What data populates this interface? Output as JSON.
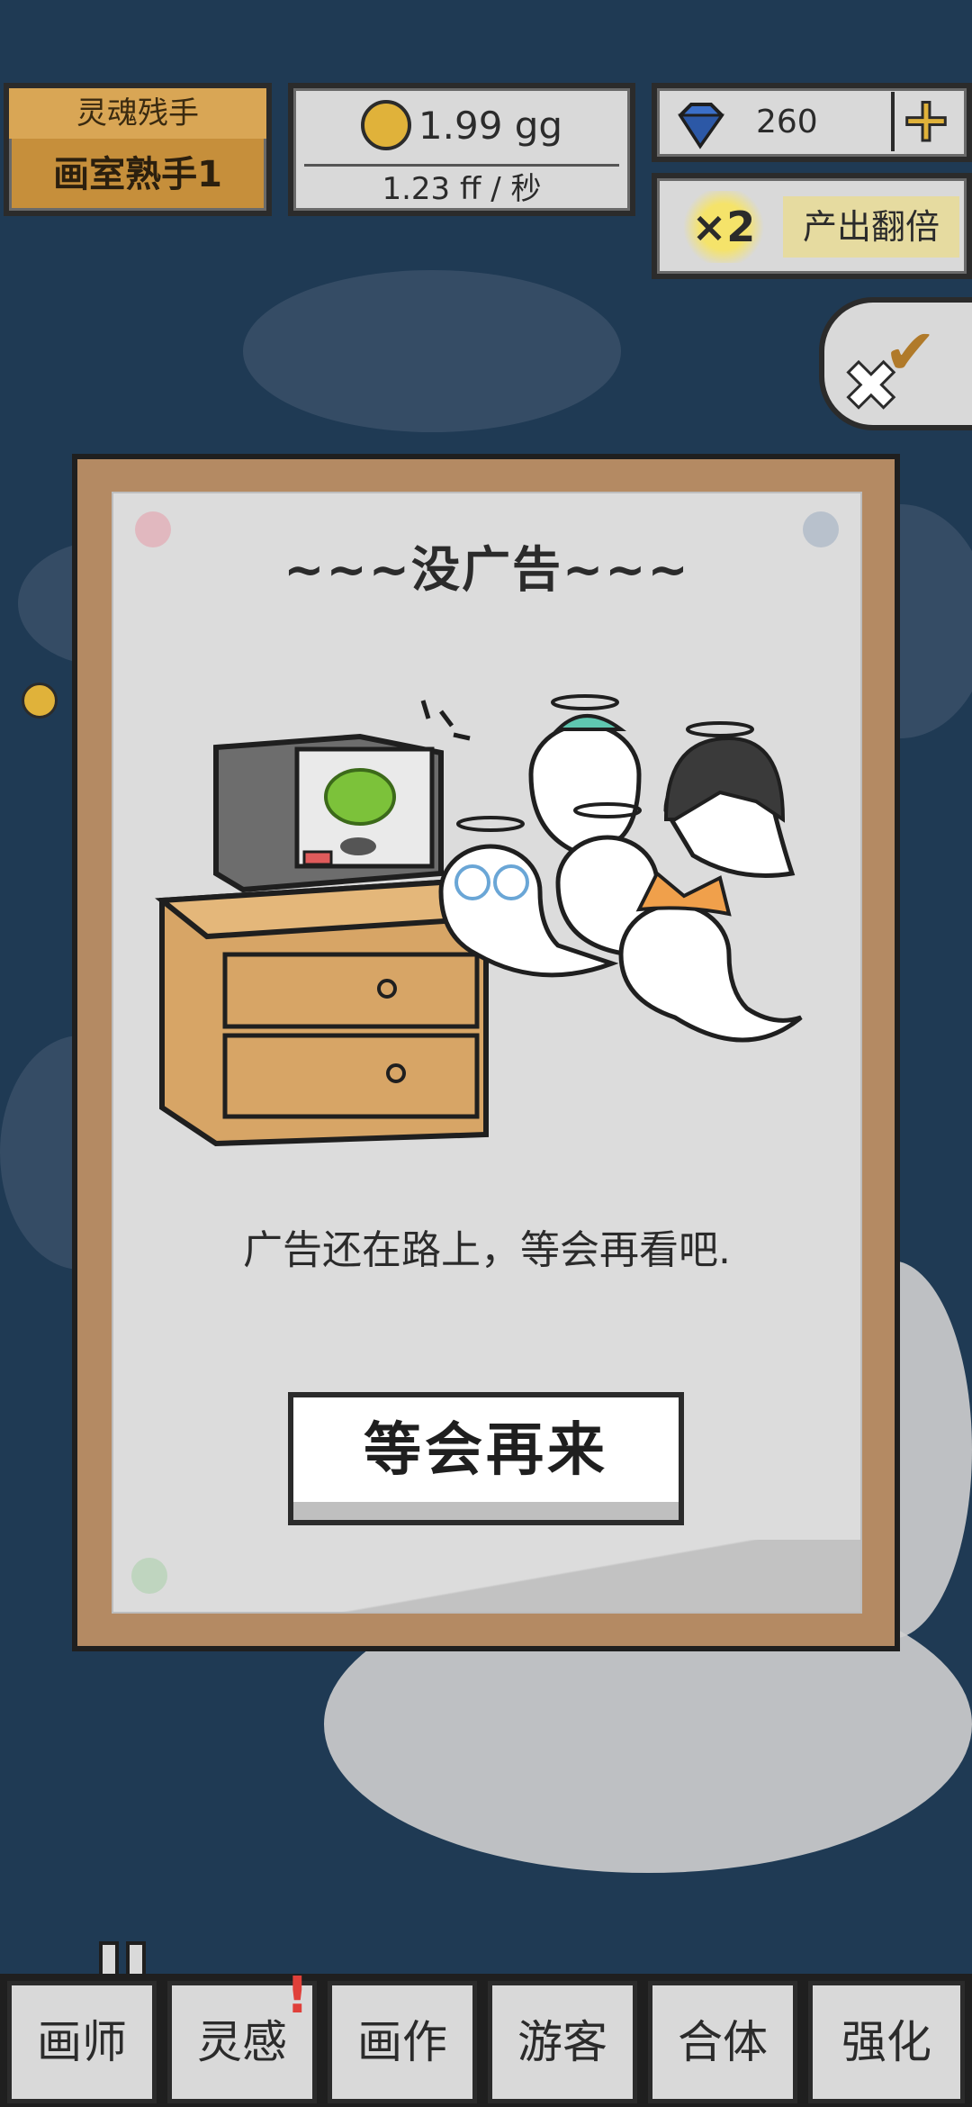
{
  "header": {
    "rank_title": "灵魂残手",
    "rank_level": "画室熟手1",
    "coins": "1.99 gg",
    "rate": "1.23 ff  /  秒",
    "gems": "260",
    "gem_plus_label": "+",
    "double_badge": "×2",
    "double_label": "产出翻倍"
  },
  "dialog": {
    "title": "~~~没广告~~~",
    "message": "广告还在路上，等会再看吧.",
    "confirm_label": "等会再来"
  },
  "nav": {
    "items": [
      {
        "label": "画师"
      },
      {
        "label": "灵感",
        "badge": "!"
      },
      {
        "label": "画作"
      },
      {
        "label": "游客"
      },
      {
        "label": "合体"
      },
      {
        "label": "强化"
      }
    ]
  },
  "colors": {
    "background": "#1f3a54",
    "frame": "#b48a63",
    "paper": "#dcdcdc",
    "coin": "#e0b23a",
    "badge": "#e0403a"
  },
  "icons": [
    "coin-icon",
    "gem-icon",
    "plus-icon",
    "x2-icon",
    "check-icon",
    "close-icon"
  ]
}
